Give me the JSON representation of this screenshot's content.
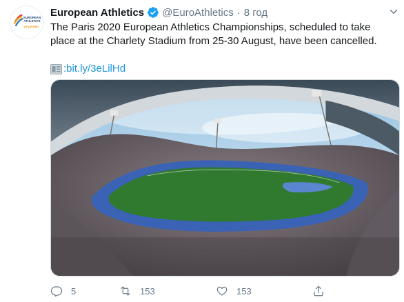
{
  "tweet": {
    "display_name": "European Athletics",
    "handle": "@EuroAthletics",
    "separator": "·",
    "time": "8 год",
    "text": "The Paris 2020 European Athletics Championships, scheduled to take place at the Charlety Stadium from 25-30 August, have been cancelled.",
    "link_emoji": "link-card-emoji",
    "link_prefix": ":",
    "link_text": "bit.ly/3eLilHd",
    "avatar_text": "EUROPEAN ATHLETICS YEARS 50",
    "media_alt": "Charlety Stadium panorama"
  },
  "actions": {
    "reply_count": "5",
    "retweet_count": "153",
    "like_count": "153",
    "reply_icon": "reply-icon",
    "retweet_icon": "retweet-icon",
    "like_icon": "like-icon",
    "share_icon": "share-icon"
  },
  "colors": {
    "link": "#1b95e0",
    "secondary_text": "#657786",
    "verified": "#1da1f2",
    "track": "#3a62b5",
    "field": "#2f7a2f"
  }
}
